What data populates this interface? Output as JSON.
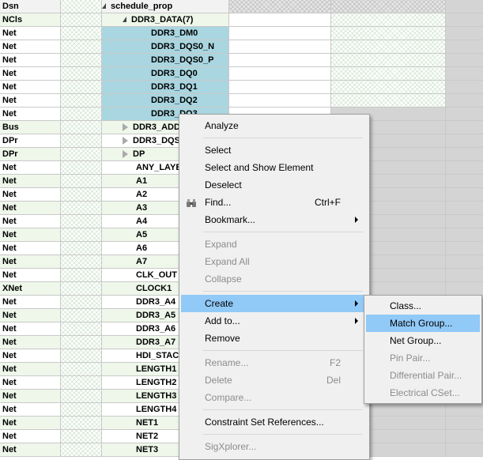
{
  "header": {
    "col0": "Dsn",
    "col2": "schedule_prop"
  },
  "rows": [
    {
      "type": "NCls",
      "name": "DDR3_DATA(7)",
      "expander": "open",
      "indent": 1,
      "style": "lgreen"
    },
    {
      "type": "Net",
      "name": "DDR3_DM0",
      "indent": 2,
      "style": "sel"
    },
    {
      "type": "Net",
      "name": "DDR3_DQS0_N",
      "indent": 2,
      "style": "sel"
    },
    {
      "type": "Net",
      "name": "DDR3_DQS0_P",
      "indent": 2,
      "style": "sel"
    },
    {
      "type": "Net",
      "name": "DDR3_DQ0",
      "indent": 2,
      "style": "sel"
    },
    {
      "type": "Net",
      "name": "DDR3_DQ1",
      "indent": 2,
      "style": "sel"
    },
    {
      "type": "Net",
      "name": "DDR3_DQ2",
      "indent": 2,
      "style": "sel"
    },
    {
      "type": "Net",
      "name": "DDR3_DQ3",
      "indent": 2,
      "style": "sel"
    },
    {
      "type": "Bus",
      "name": "DDR3_ADDR",
      "expander": "closed",
      "indent": 1,
      "style": "lgreen"
    },
    {
      "type": "DPr",
      "name": "DDR3_DQS",
      "expander": "closed",
      "indent": 1,
      "style": "white"
    },
    {
      "type": "DPr",
      "name": "DP",
      "expander": "closed",
      "indent": 1,
      "style": "lgreen"
    },
    {
      "type": "Net",
      "name": "ANY_LAYER",
      "indent": 1,
      "style": "white"
    },
    {
      "type": "Net",
      "name": "A1",
      "indent": 1,
      "style": "lgreen"
    },
    {
      "type": "Net",
      "name": "A2",
      "indent": 1,
      "style": "white"
    },
    {
      "type": "Net",
      "name": "A3",
      "indent": 1,
      "style": "lgreen"
    },
    {
      "type": "Net",
      "name": "A4",
      "indent": 1,
      "style": "white"
    },
    {
      "type": "Net",
      "name": "A5",
      "indent": 1,
      "style": "lgreen"
    },
    {
      "type": "Net",
      "name": "A6",
      "indent": 1,
      "style": "white"
    },
    {
      "type": "Net",
      "name": "A7",
      "indent": 1,
      "style": "lgreen"
    },
    {
      "type": "Net",
      "name": "CLK_OUT",
      "indent": 1,
      "style": "white"
    },
    {
      "type": "XNet",
      "name": "CLOCK1",
      "indent": 1,
      "style": "lgreen"
    },
    {
      "type": "Net",
      "name": "DDR3_A4",
      "indent": 1,
      "style": "white"
    },
    {
      "type": "Net",
      "name": "DDR3_A5",
      "indent": 1,
      "style": "lgreen"
    },
    {
      "type": "Net",
      "name": "DDR3_A6",
      "indent": 1,
      "style": "white"
    },
    {
      "type": "Net",
      "name": "DDR3_A7",
      "indent": 1,
      "style": "lgreen"
    },
    {
      "type": "Net",
      "name": "HDI_STACK",
      "indent": 1,
      "style": "white"
    },
    {
      "type": "Net",
      "name": "LENGTH1",
      "indent": 1,
      "style": "lgreen"
    },
    {
      "type": "Net",
      "name": "LENGTH2",
      "indent": 1,
      "style": "white"
    },
    {
      "type": "Net",
      "name": "LENGTH3",
      "indent": 1,
      "style": "lgreen"
    },
    {
      "type": "Net",
      "name": "LENGTH4",
      "indent": 1,
      "style": "white"
    },
    {
      "type": "Net",
      "name": "NET1",
      "indent": 1,
      "style": "lgreen"
    },
    {
      "type": "Net",
      "name": "NET2",
      "indent": 1,
      "style": "white"
    },
    {
      "type": "Net",
      "name": "NET3",
      "indent": 1,
      "style": "lgreen"
    }
  ],
  "context_menu": {
    "items": [
      {
        "label": "Analyze",
        "name": "menu-analyze"
      },
      {
        "sep": true
      },
      {
        "label": "Select",
        "name": "menu-select"
      },
      {
        "label": "Select and Show Element",
        "name": "menu-select-and-show"
      },
      {
        "label": "Deselect",
        "name": "menu-deselect"
      },
      {
        "label": "Find...",
        "shortcut": "Ctrl+F",
        "icon": "binoculars-icon",
        "name": "menu-find"
      },
      {
        "label": "Bookmark...",
        "submenu": true,
        "name": "menu-bookmark"
      },
      {
        "sep": true
      },
      {
        "label": "Expand",
        "disabled": true,
        "name": "menu-expand"
      },
      {
        "label": "Expand All",
        "disabled": true,
        "name": "menu-expand-all"
      },
      {
        "label": "Collapse",
        "disabled": true,
        "name": "menu-collapse"
      },
      {
        "sep": true
      },
      {
        "label": "Create",
        "submenu": true,
        "highlighted": true,
        "name": "menu-create"
      },
      {
        "label": "Add to...",
        "submenu": true,
        "name": "menu-add-to"
      },
      {
        "label": "Remove",
        "name": "menu-remove"
      },
      {
        "sep": true
      },
      {
        "label": "Rename...",
        "shortcut": "F2",
        "disabled": true,
        "name": "menu-rename"
      },
      {
        "label": "Delete",
        "shortcut": "Del",
        "disabled": true,
        "name": "menu-delete"
      },
      {
        "label": "Compare...",
        "disabled": true,
        "name": "menu-compare"
      },
      {
        "sep": true
      },
      {
        "label": "Constraint Set References...",
        "name": "menu-constraint-set-references"
      },
      {
        "sep": true
      },
      {
        "label": "SigXplorer...",
        "disabled": true,
        "name": "menu-sigxplorer"
      }
    ]
  },
  "submenu": {
    "items": [
      {
        "label": "Class...",
        "name": "submenu-class"
      },
      {
        "label": "Match Group...",
        "highlighted": true,
        "name": "submenu-match-group"
      },
      {
        "label": "Net Group...",
        "name": "submenu-net-group"
      },
      {
        "label": "Pin Pair...",
        "disabled": true,
        "name": "submenu-pin-pair"
      },
      {
        "label": "Differential Pair...",
        "disabled": true,
        "name": "submenu-differential-pair"
      },
      {
        "label": "Electrical CSet...",
        "disabled": true,
        "name": "submenu-electrical-cset"
      }
    ]
  },
  "colors": {
    "selected_row": "#a9d6e0",
    "menu_highlight": "#91c9f7",
    "row_tint": "#eef7ea"
  }
}
